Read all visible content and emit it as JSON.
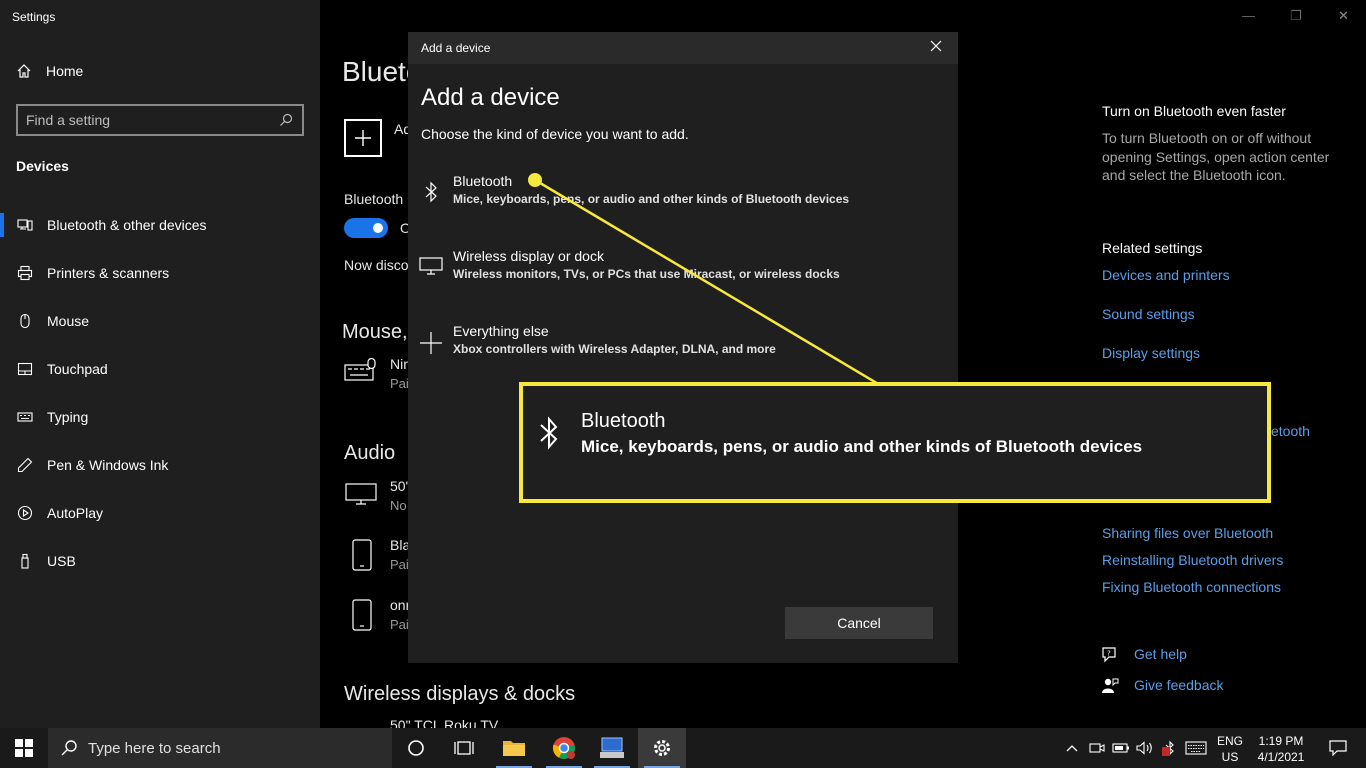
{
  "window": {
    "app_title": "Settings",
    "minimize_icon": "—",
    "maximize_icon": "❐",
    "close_icon": "✕"
  },
  "nav": {
    "home_label": "Home",
    "search_placeholder": "Find a setting",
    "section_title": "Devices",
    "items": [
      {
        "label": "Bluetooth & other devices",
        "icon": "bluetooth-devices-icon",
        "active": true
      },
      {
        "label": "Printers & scanners",
        "icon": "printer-icon"
      },
      {
        "label": "Mouse",
        "icon": "mouse-icon"
      },
      {
        "label": "Touchpad",
        "icon": "touchpad-icon"
      },
      {
        "label": "Typing",
        "icon": "keyboard-icon"
      },
      {
        "label": "Pen & Windows Ink",
        "icon": "pen-icon"
      },
      {
        "label": "AutoPlay",
        "icon": "autoplay-icon"
      },
      {
        "label": "USB",
        "icon": "usb-icon"
      }
    ]
  },
  "main_fragments": {
    "page_title": "Blueto",
    "add_label": "Ad",
    "bluetooth_label": "Bluetooth",
    "toggle_text": "O",
    "discover_text": "Now disco",
    "mouse_heading": "Mouse,",
    "mouse_device_name": "Nin",
    "mouse_device_status": "Pai",
    "audio_heading": "Audio",
    "audio_1_name": "50\"",
    "audio_1_status": "No",
    "audio_2_name": "Bla",
    "audio_2_status": "Pai",
    "audio_3_name": "onn",
    "audio_3_status": "Pai",
    "wireless_heading": "Wireless displays & docks",
    "wireless_device_name": "50\" TCL Roku TV"
  },
  "right_panel": {
    "faster_heading": "Turn on Bluetooth even faster",
    "faster_text_1": "To turn Bluetooth on or off without",
    "faster_text_2": "opening Settings, open action center",
    "faster_text_3": "and select the Bluetooth icon.",
    "related_heading": "Related settings",
    "link_devices_printers": "Devices and printers",
    "link_sound": "Sound settings",
    "link_display": "Display settings",
    "link_partial": "etooth",
    "link_sharing": "Sharing files over Bluetooth",
    "link_reinstall": "Reinstalling Bluetooth drivers",
    "link_fixing": "Fixing Bluetooth connections",
    "get_help": "Get help",
    "give_feedback": "Give feedback"
  },
  "dialog": {
    "title_bar": "Add a device",
    "heading": "Add a device",
    "subtitle": "Choose the kind of device you want to add.",
    "options": [
      {
        "name": "Bluetooth",
        "desc": "Mice, keyboards, pens, or audio and other kinds of Bluetooth devices",
        "icon": "bluetooth-icon"
      },
      {
        "name": "Wireless display or dock",
        "desc": "Wireless monitors, TVs, or PCs that use Miracast, or wireless docks",
        "icon": "monitor-icon"
      },
      {
        "name": "Everything else",
        "desc": "Xbox controllers with Wireless Adapter, DLNA, and more",
        "icon": "plus-icon"
      }
    ],
    "cancel_label": "Cancel"
  },
  "callout": {
    "name": "Bluetooth",
    "desc": "Mice, keyboards, pens, or audio and other kinds of Bluetooth devices",
    "border_color": "#f7e83c"
  },
  "taskbar": {
    "search_placeholder": "Type here to search",
    "lang_1": "ENG",
    "lang_2": "US",
    "time": "1:19 PM",
    "date": "4/1/2021"
  },
  "colors": {
    "accent": "#1a73e8",
    "link": "#5b9ee8",
    "highlight": "#f7e83c"
  }
}
